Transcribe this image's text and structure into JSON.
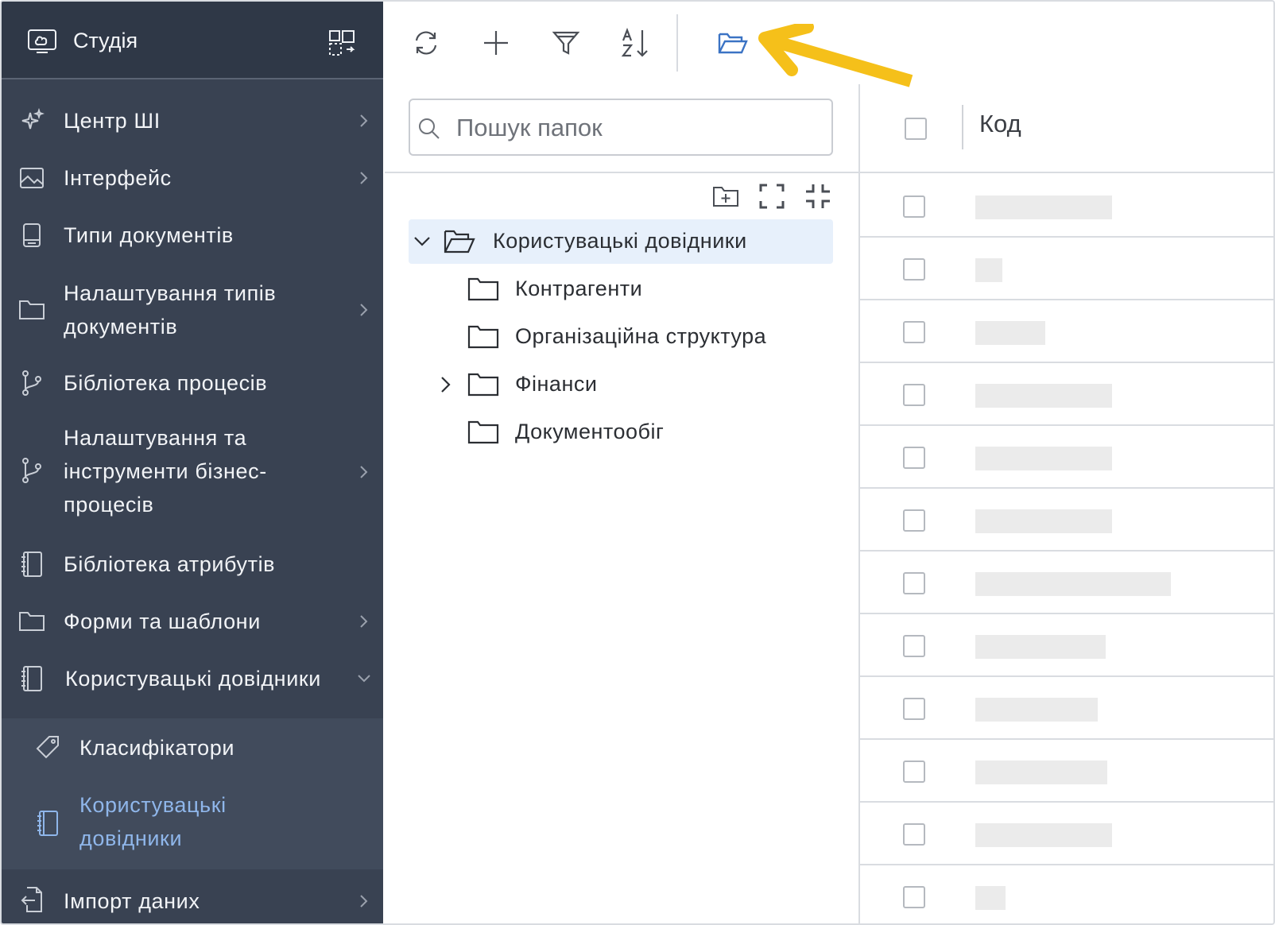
{
  "sidebar": {
    "title": "Студія",
    "items": [
      {
        "label": "Центр ШІ",
        "icon": "sparkle-icon",
        "chevron": "right"
      },
      {
        "label": "Інтерфейс",
        "icon": "image-icon",
        "chevron": "right"
      },
      {
        "label": "Типи документів",
        "icon": "document-type-icon",
        "chevron": ""
      },
      {
        "label_lines": [
          "Налаштування типів",
          "документів"
        ],
        "icon": "folder-icon",
        "chevron": "right"
      },
      {
        "label": "Бібліотека процесів",
        "icon": "branch-icon",
        "chevron": ""
      },
      {
        "label_lines": [
          "Налаштування та",
          "інструменти бізнес-",
          "процесів"
        ],
        "icon": "branch-icon",
        "chevron": "right"
      },
      {
        "label": "Бібліотека атрибутів",
        "icon": "notebook-icon",
        "chevron": ""
      },
      {
        "label": "Форми та шаблони",
        "icon": "folder-icon",
        "chevron": "right"
      },
      {
        "label": "Користувацькі довідники",
        "icon": "notebook-icon",
        "chevron": "down"
      },
      {
        "label": "Класифікатори",
        "icon": "tag-icon",
        "sub": true
      },
      {
        "label_lines": [
          "Користувацькі",
          "довідники"
        ],
        "icon": "notebook-icon",
        "sub": true,
        "active": true
      },
      {
        "label": "Імпорт даних",
        "icon": "import-icon",
        "chevron": "right"
      }
    ]
  },
  "toolbar": {
    "buttons": [
      "refresh-icon",
      "plus-icon",
      "filter-icon",
      "sort-az-icon",
      "folder-open-icon"
    ],
    "accent": "#3b73c4",
    "arrow_color": "#f5c01a"
  },
  "folders": {
    "search_placeholder": "Пошук папок",
    "tree": [
      {
        "label": "Користувацькі довідники",
        "expanded": true,
        "selected": true,
        "level": 0
      },
      {
        "label": "Контрагенти",
        "level": 1
      },
      {
        "label": "Організаційна структура",
        "level": 1
      },
      {
        "label": "Фінанси",
        "level": 1,
        "has_children": true
      },
      {
        "label": "Документообіг",
        "level": 1
      }
    ]
  },
  "grid": {
    "column_header": "Код",
    "row_count": 12
  }
}
